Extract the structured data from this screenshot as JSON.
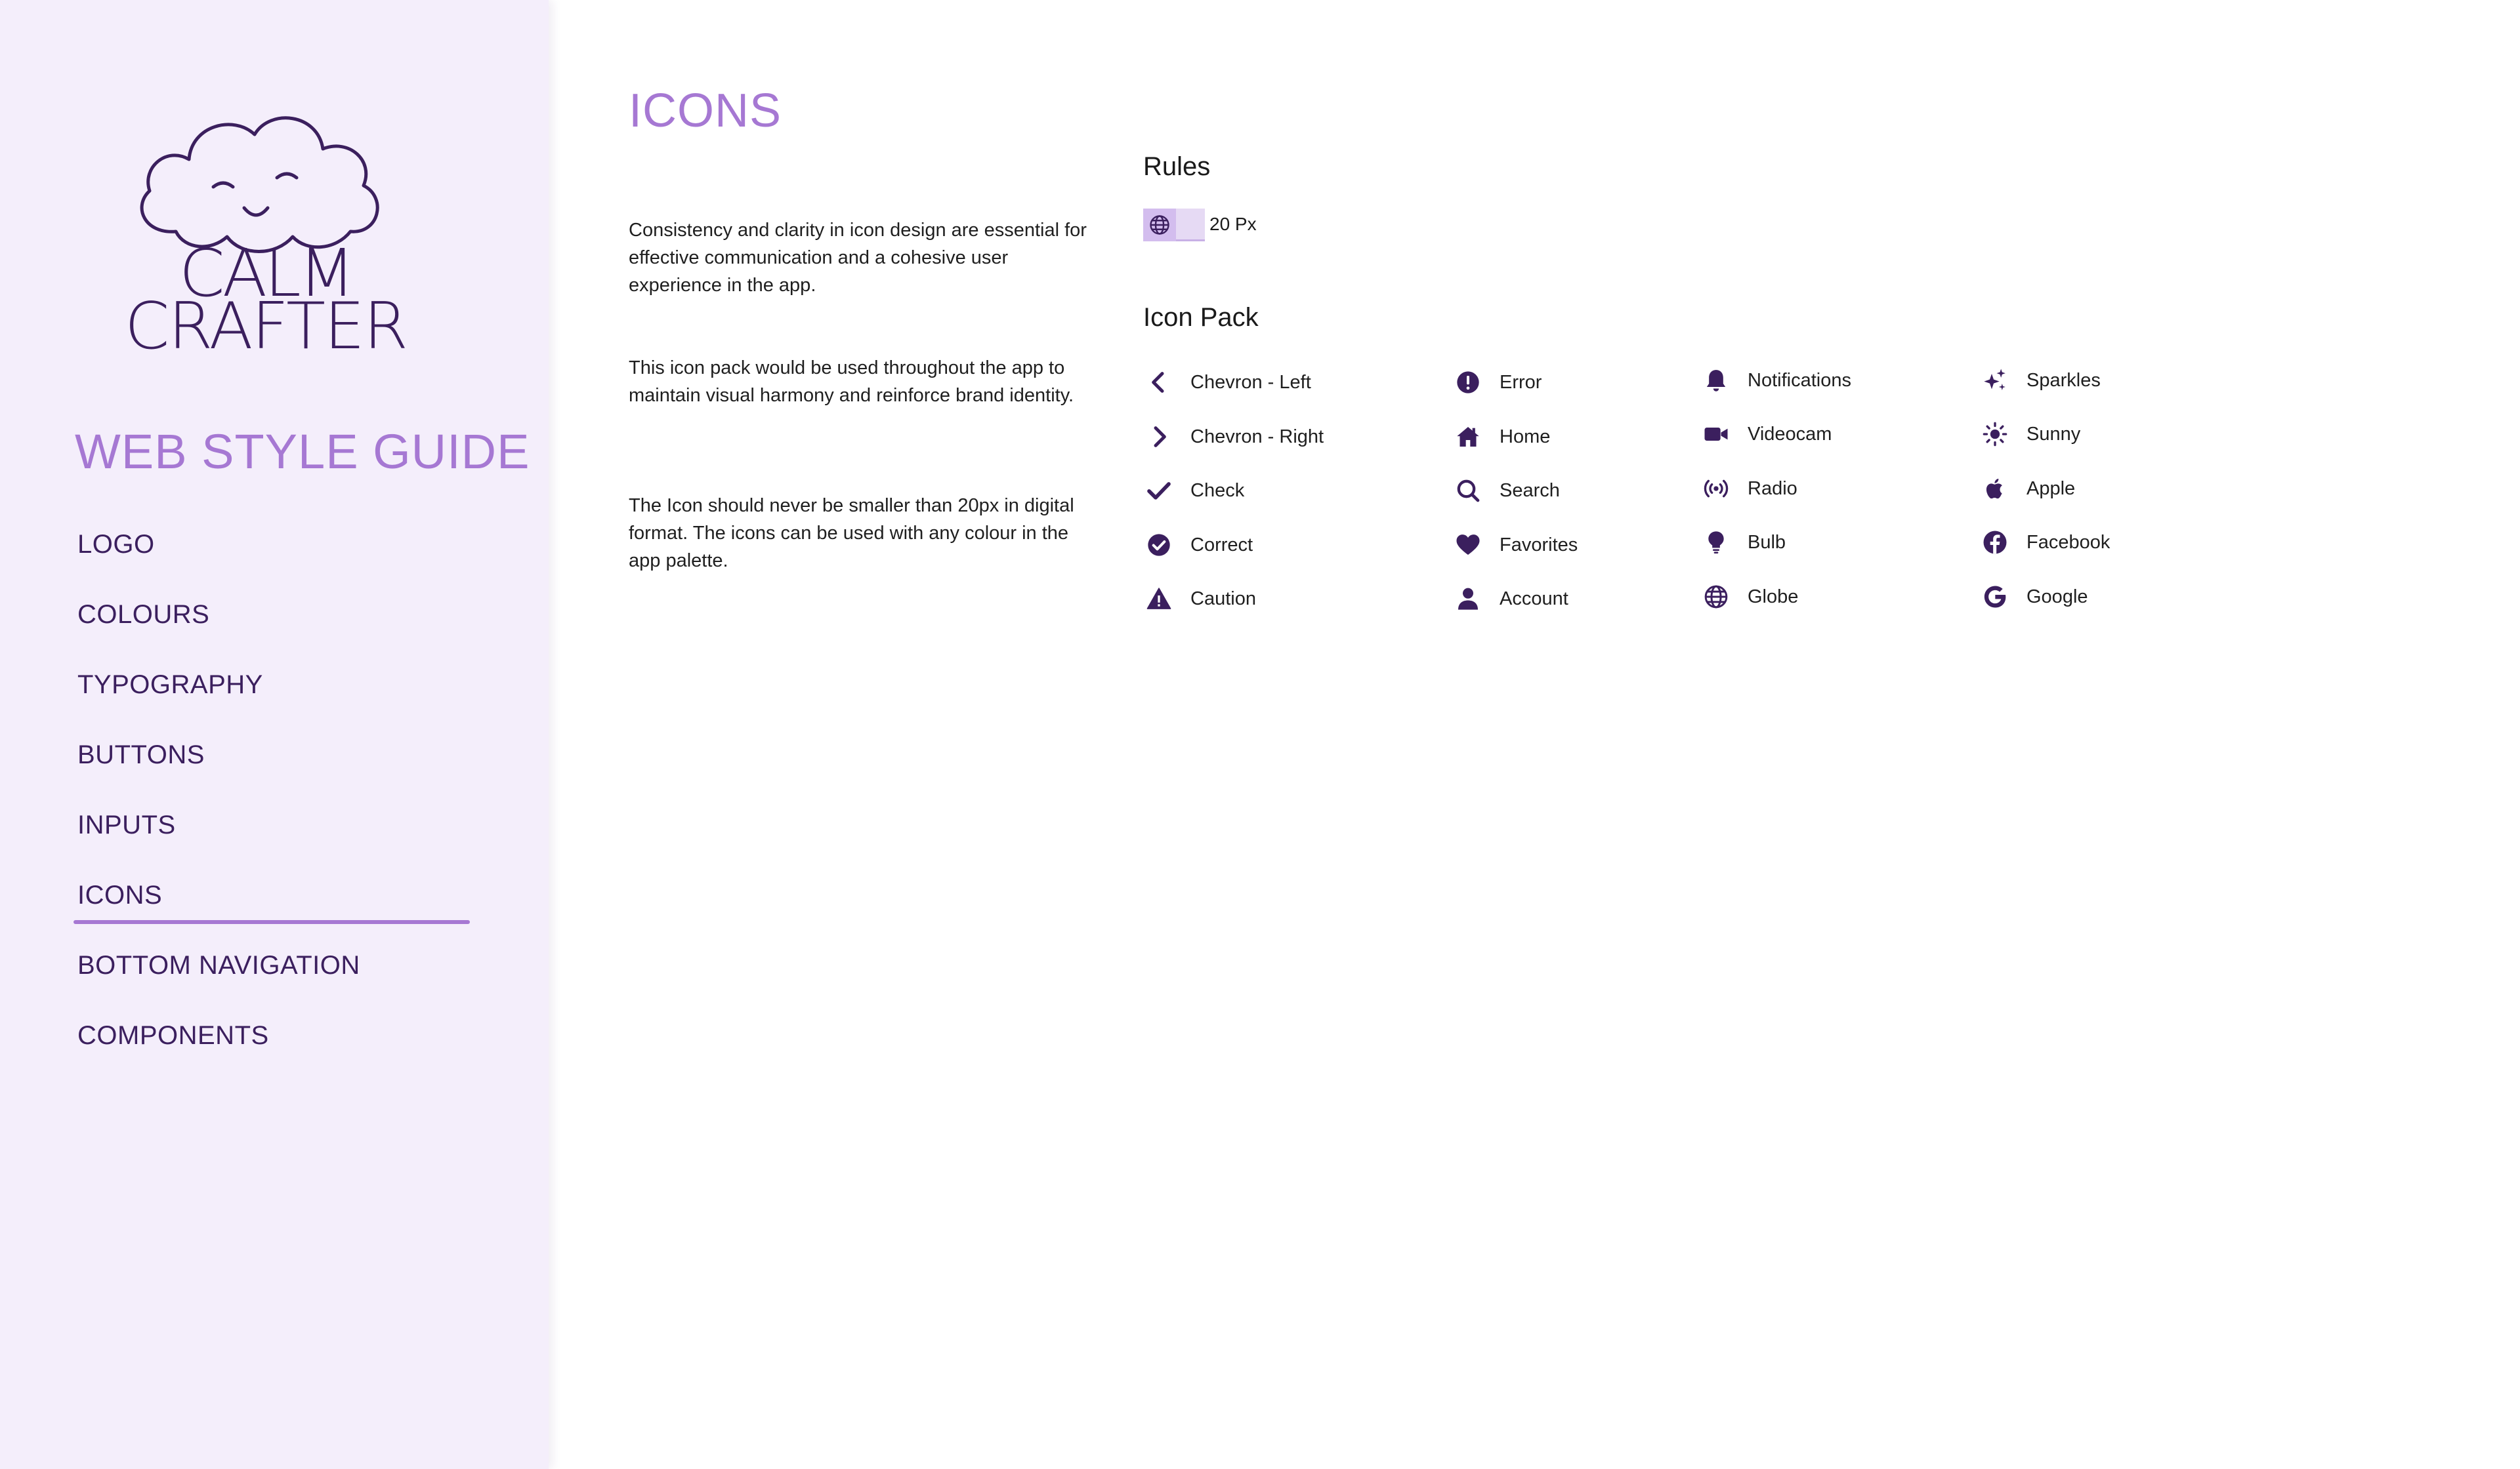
{
  "brand": {
    "name_line1": "CALM",
    "name_line2": "CRAFTER",
    "primary_color": "#3b1f5e",
    "accent_color": "#a678d3",
    "sidebar_bg": "#f4eefb"
  },
  "sidebar": {
    "title": "WEB STYLE GUIDE",
    "items": [
      {
        "label": "LOGO",
        "active": false
      },
      {
        "label": "COLOURS",
        "active": false
      },
      {
        "label": "TYPOGRAPHY",
        "active": false
      },
      {
        "label": "BUTTONS",
        "active": false
      },
      {
        "label": "INPUTS",
        "active": false
      },
      {
        "label": "ICONS",
        "active": true
      },
      {
        "label": "BOTTOM NAVIGATION",
        "active": false
      },
      {
        "label": "COMPONENTS",
        "active": false
      }
    ]
  },
  "main": {
    "title": "ICONS",
    "paragraphs": [
      "Consistency and clarity in icon design are essential for effective communication and a cohesive user experience in the app.",
      "This icon pack would be used throughout the app to maintain visual harmony and reinforce brand identity.",
      "The Icon should never be smaller than 20px in digital format. The icons can be used with any colour in the app palette."
    ],
    "rules": {
      "title": "Rules",
      "sample_icon": "globe-icon",
      "size_label": "20 Px"
    },
    "icon_pack": {
      "title": "Icon Pack",
      "columns": [
        [
          {
            "label": "Chevron - Left",
            "icon": "chevron-left-icon"
          },
          {
            "label": "Chevron - Right",
            "icon": "chevron-right-icon"
          },
          {
            "label": "Check",
            "icon": "check-icon"
          },
          {
            "label": "Correct",
            "icon": "correct-icon"
          },
          {
            "label": "Caution",
            "icon": "caution-icon"
          }
        ],
        [
          {
            "label": "Error",
            "icon": "error-icon"
          },
          {
            "label": "Home",
            "icon": "home-icon"
          },
          {
            "label": "Search",
            "icon": "search-icon"
          },
          {
            "label": "Favorites",
            "icon": "favorites-icon"
          },
          {
            "label": "Account",
            "icon": "account-icon"
          }
        ],
        [
          {
            "label": "Notifications",
            "icon": "notifications-icon"
          },
          {
            "label": "Videocam",
            "icon": "videocam-icon"
          },
          {
            "label": "Radio",
            "icon": "radio-icon"
          },
          {
            "label": "Bulb",
            "icon": "bulb-icon"
          },
          {
            "label": "Globe",
            "icon": "globe-icon"
          }
        ],
        [
          {
            "label": "Sparkles",
            "icon": "sparkles-icon"
          },
          {
            "label": "Sunny",
            "icon": "sunny-icon"
          },
          {
            "label": "Apple",
            "icon": "apple-icon"
          },
          {
            "label": "Facebook",
            "icon": "facebook-icon"
          },
          {
            "label": "Google",
            "icon": "google-icon"
          }
        ]
      ]
    }
  }
}
